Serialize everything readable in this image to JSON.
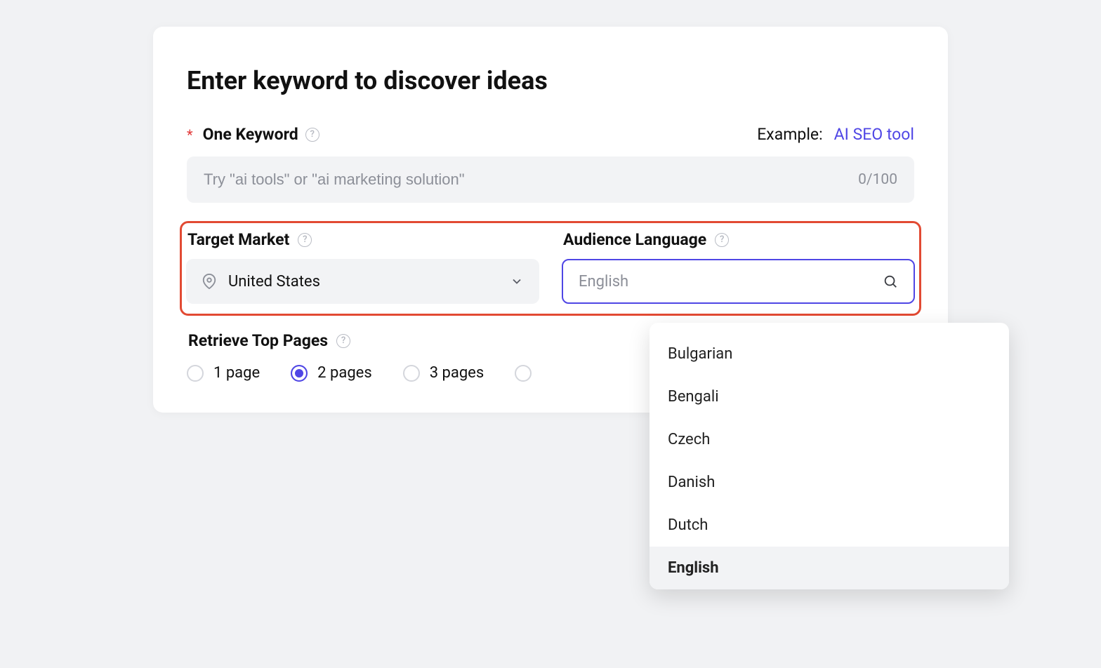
{
  "title": "Enter keyword to discover ideas",
  "keyword": {
    "label": "One Keyword",
    "placeholder": "Try \"ai tools\" or \"ai marketing solution\"",
    "counter": "0/100",
    "example_label": "Example:",
    "example_value": "AI SEO tool"
  },
  "target_market": {
    "label": "Target Market",
    "value": "United States"
  },
  "audience_language": {
    "label": "Audience Language",
    "value": "English",
    "options": [
      "Bulgarian",
      "Bengali",
      "Czech",
      "Danish",
      "Dutch",
      "English"
    ],
    "selected": "English"
  },
  "retrieve": {
    "label": "Retrieve Top Pages",
    "options": [
      "1 page",
      "2 pages",
      "3 pages"
    ],
    "selected_index": 1
  }
}
